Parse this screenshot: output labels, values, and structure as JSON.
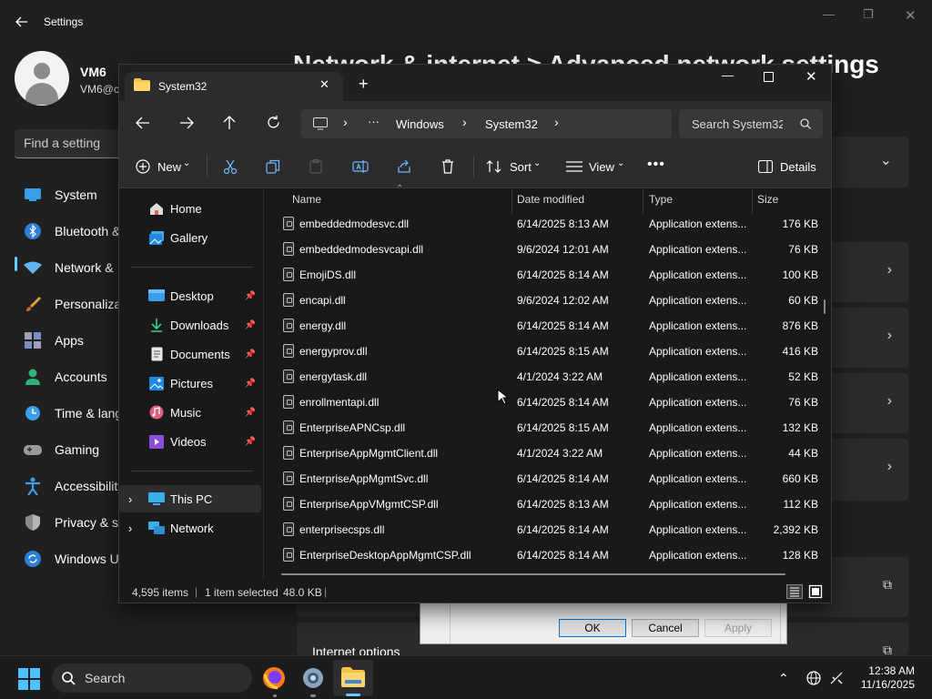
{
  "settings": {
    "title": "Settings",
    "user": {
      "name": "VM6",
      "email": "VM6@c"
    },
    "find_placeholder": "Find a setting",
    "page_title": "Network & internet > Advanced network settings",
    "nav": [
      {
        "label": "System",
        "icon": "monitor-icon"
      },
      {
        "label": "Bluetooth &",
        "icon": "bluetooth-icon"
      },
      {
        "label": "Network &",
        "icon": "wifi-icon"
      },
      {
        "label": "Personaliza",
        "icon": "brush-icon"
      },
      {
        "label": "Apps",
        "icon": "apps-icon"
      },
      {
        "label": "Accounts",
        "icon": "person-icon"
      },
      {
        "label": "Time & lang",
        "icon": "clock-globe-icon"
      },
      {
        "label": "Gaming",
        "icon": "gamepad-icon"
      },
      {
        "label": "Accessibility",
        "icon": "accessibility-icon"
      },
      {
        "label": "Privacy & se",
        "icon": "shield-icon"
      },
      {
        "label": "Windows U",
        "icon": "update-icon"
      }
    ],
    "internet_options": "Internet options"
  },
  "dialog": {
    "ok": "OK",
    "cancel": "Cancel",
    "apply": "Apply"
  },
  "explorer": {
    "tab_title": "System32",
    "breadcrumb": [
      "Windows",
      "System32"
    ],
    "search_placeholder": "Search System32",
    "toolbar": {
      "new": "New",
      "sort": "Sort",
      "view": "View",
      "details": "Details"
    },
    "nav": {
      "home": "Home",
      "gallery": "Gallery",
      "quick": [
        "Desktop",
        "Downloads",
        "Documents",
        "Pictures",
        "Music",
        "Videos"
      ],
      "this_pc": "This PC",
      "network": "Network"
    },
    "columns": {
      "name": "Name",
      "date": "Date modified",
      "type": "Type",
      "size": "Size"
    },
    "files": [
      {
        "name": "embeddedmodesvc.dll",
        "date": "6/14/2025 8:13 AM",
        "type": "Application extens...",
        "size": "176 KB"
      },
      {
        "name": "embeddedmodesvcapi.dll",
        "date": "9/6/2024 12:01 AM",
        "type": "Application extens...",
        "size": "76 KB"
      },
      {
        "name": "EmojiDS.dll",
        "date": "6/14/2025 8:14 AM",
        "type": "Application extens...",
        "size": "100 KB"
      },
      {
        "name": "encapi.dll",
        "date": "9/6/2024 12:02 AM",
        "type": "Application extens...",
        "size": "60 KB"
      },
      {
        "name": "energy.dll",
        "date": "6/14/2025 8:14 AM",
        "type": "Application extens...",
        "size": "876 KB"
      },
      {
        "name": "energyprov.dll",
        "date": "6/14/2025 8:15 AM",
        "type": "Application extens...",
        "size": "416 KB"
      },
      {
        "name": "energytask.dll",
        "date": "4/1/2024 3:22 AM",
        "type": "Application extens...",
        "size": "52 KB"
      },
      {
        "name": "enrollmentapi.dll",
        "date": "6/14/2025 8:14 AM",
        "type": "Application extens...",
        "size": "76 KB"
      },
      {
        "name": "EnterpriseAPNCsp.dll",
        "date": "6/14/2025 8:15 AM",
        "type": "Application extens...",
        "size": "132 KB"
      },
      {
        "name": "EnterpriseAppMgmtClient.dll",
        "date": "4/1/2024 3:22 AM",
        "type": "Application extens...",
        "size": "44 KB"
      },
      {
        "name": "EnterpriseAppMgmtSvc.dll",
        "date": "6/14/2025 8:14 AM",
        "type": "Application extens...",
        "size": "660 KB"
      },
      {
        "name": "EnterpriseAppVMgmtCSP.dll",
        "date": "6/14/2025 8:13 AM",
        "type": "Application extens...",
        "size": "112 KB"
      },
      {
        "name": "enterprisecsps.dll",
        "date": "6/14/2025 8:14 AM",
        "type": "Application extens...",
        "size": "2,392 KB"
      },
      {
        "name": "EnterpriseDesktopAppMgmtCSP.dll",
        "date": "6/14/2025 8:14 AM",
        "type": "Application extens...",
        "size": "128 KB"
      }
    ],
    "status": {
      "items": "4,595 items",
      "selected": "1 item selected",
      "size": "48.0 KB"
    }
  },
  "taskbar": {
    "search": "Search",
    "time": "12:38 AM",
    "date": "11/16/2025"
  },
  "colors": {
    "accent": "#60cdff",
    "folder": "#f5c244"
  }
}
